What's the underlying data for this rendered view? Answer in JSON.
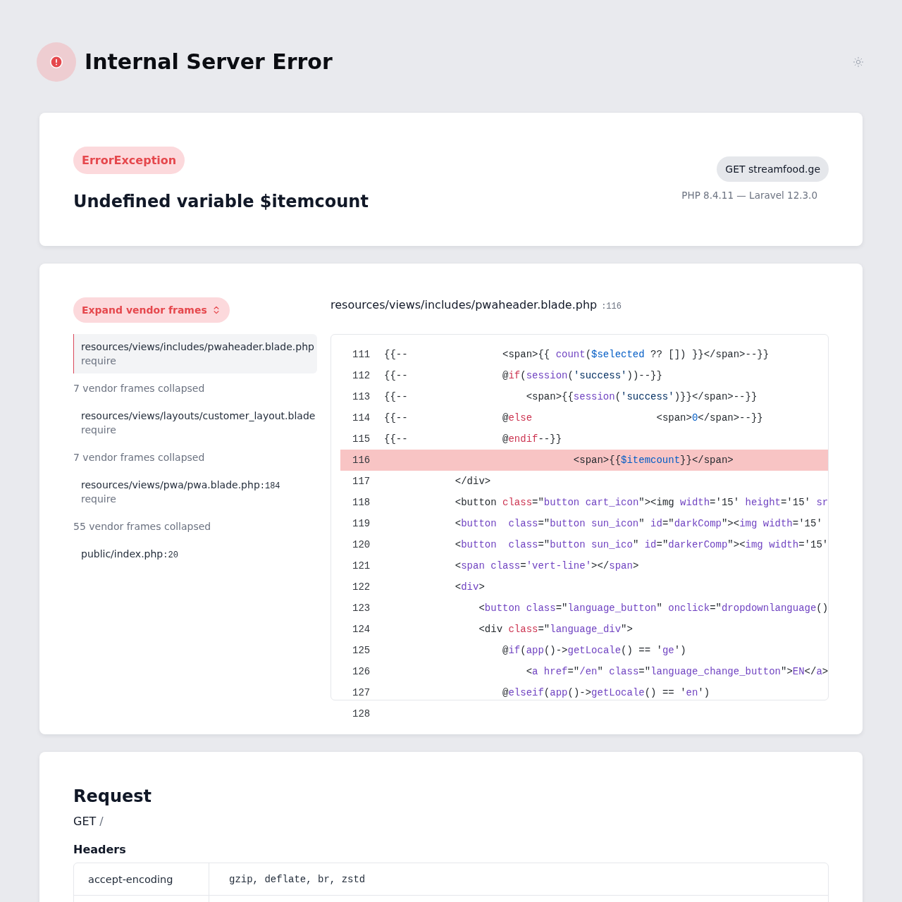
{
  "header": {
    "title": "Internal Server Error"
  },
  "exception": {
    "type": "ErrorException",
    "message": "Undefined variable $itemcount",
    "request": "GET streamfood.ge",
    "versions": "PHP 8.4.11 — Laravel 12.3.0"
  },
  "trace": {
    "expand_button": "Expand vendor frames",
    "frames": [
      {
        "kind": "frame",
        "file": "resources/views/includes/pwaheader.blade.php",
        "call": "require",
        "selected": true
      },
      {
        "kind": "collapsed",
        "label": "7 vendor frames collapsed"
      },
      {
        "kind": "frame",
        "file": "resources/views/layouts/customer_layout.blade",
        "call": "require",
        "selected": false
      },
      {
        "kind": "collapsed",
        "label": "7 vendor frames collapsed"
      },
      {
        "kind": "frame",
        "file": "resources/views/pwa/pwa.blade.php",
        "line": ":184",
        "call": "require",
        "selected": false
      },
      {
        "kind": "collapsed",
        "label": "55 vendor frames collapsed"
      },
      {
        "kind": "frame",
        "file": "public/index.php",
        "line": ":20",
        "selected": false
      }
    ]
  },
  "code": {
    "file": "resources/views/includes/pwaheader.blade.php",
    "line": ":116",
    "lines": [
      {
        "number": "111",
        "highlighted": false,
        "tokens": [
          {
            "kind": "plain",
            "text": "{{--                <span>{{ "
          },
          {
            "kind": "name",
            "text": "count"
          },
          {
            "kind": "plain",
            "text": "("
          },
          {
            "kind": "variable",
            "text": "$selected"
          },
          {
            "kind": "plain",
            "text": " ?? []) }}</span>--}}"
          }
        ]
      },
      {
        "number": "112",
        "highlighted": false,
        "tokens": [
          {
            "kind": "plain",
            "text": "{{--                @"
          },
          {
            "kind": "keyword",
            "text": "if"
          },
          {
            "kind": "plain",
            "text": "("
          },
          {
            "kind": "name",
            "text": "session"
          },
          {
            "kind": "plain",
            "text": "("
          },
          {
            "kind": "string",
            "text": "'success'"
          },
          {
            "kind": "plain",
            "text": "))--}}"
          }
        ]
      },
      {
        "number": "113",
        "highlighted": false,
        "tokens": [
          {
            "kind": "plain",
            "text": "{{--                    <span>{{"
          },
          {
            "kind": "name",
            "text": "session"
          },
          {
            "kind": "plain",
            "text": "("
          },
          {
            "kind": "string",
            "text": "'success'"
          },
          {
            "kind": "plain",
            "text": ")}}</span>--}}"
          }
        ]
      },
      {
        "number": "114",
        "highlighted": false,
        "tokens": [
          {
            "kind": "plain",
            "text": "{{--                @"
          },
          {
            "kind": "keyword",
            "text": "else"
          },
          {
            "kind": "plain",
            "text": "                     <span>"
          },
          {
            "kind": "variable",
            "text": "0"
          },
          {
            "kind": "plain",
            "text": "</span>--}}"
          }
        ]
      },
      {
        "number": "115",
        "highlighted": false,
        "tokens": [
          {
            "kind": "plain",
            "text": "{{--                @"
          },
          {
            "kind": "keyword",
            "text": "endif"
          },
          {
            "kind": "plain",
            "text": "--}}"
          }
        ]
      },
      {
        "number": "116",
        "highlighted": true,
        "tokens": [
          {
            "kind": "plain",
            "text": "                                <span>{{"
          },
          {
            "kind": "variable",
            "text": "$itemcount"
          },
          {
            "kind": "plain",
            "text": "}}</span>"
          }
        ]
      },
      {
        "number": "117",
        "highlighted": false,
        "tokens": [
          {
            "kind": "plain",
            "text": "            </div>"
          }
        ]
      },
      {
        "number": "118",
        "highlighted": false,
        "tokens": [
          {
            "kind": "plain",
            "text": "            <button "
          },
          {
            "kind": "keyword",
            "text": "class"
          },
          {
            "kind": "plain",
            "text": "=\""
          },
          {
            "kind": "name",
            "text": "button cart_icon"
          },
          {
            "kind": "plain",
            "text": "\"><img "
          },
          {
            "kind": "name",
            "text": "width"
          },
          {
            "kind": "plain",
            "text": "='15' "
          },
          {
            "kind": "name",
            "text": "height"
          },
          {
            "kind": "plain",
            "text": "='15' "
          },
          {
            "kind": "name",
            "text": "sr"
          }
        ]
      },
      {
        "number": "119",
        "highlighted": false,
        "tokens": [
          {
            "kind": "plain",
            "text": "            <"
          },
          {
            "kind": "name",
            "text": "button  class"
          },
          {
            "kind": "plain",
            "text": "=\""
          },
          {
            "kind": "name",
            "text": "button sun_icon"
          },
          {
            "kind": "plain",
            "text": "\" "
          },
          {
            "kind": "name",
            "text": "id"
          },
          {
            "kind": "plain",
            "text": "=\""
          },
          {
            "kind": "name",
            "text": "darkComp"
          },
          {
            "kind": "plain",
            "text": "\"><"
          },
          {
            "kind": "name",
            "text": "img width"
          },
          {
            "kind": "plain",
            "text": "='15'"
          }
        ]
      },
      {
        "number": "120",
        "highlighted": false,
        "tokens": [
          {
            "kind": "plain",
            "text": "            <"
          },
          {
            "kind": "name",
            "text": "button  class"
          },
          {
            "kind": "plain",
            "text": "=\""
          },
          {
            "kind": "name",
            "text": "button sun_ico"
          },
          {
            "kind": "plain",
            "text": "\" "
          },
          {
            "kind": "name",
            "text": "id"
          },
          {
            "kind": "plain",
            "text": "=\""
          },
          {
            "kind": "name",
            "text": "darkerComp"
          },
          {
            "kind": "plain",
            "text": "\"><"
          },
          {
            "kind": "name",
            "text": "img width"
          },
          {
            "kind": "plain",
            "text": "='15'"
          }
        ]
      },
      {
        "number": "121",
        "highlighted": false,
        "tokens": [
          {
            "kind": "plain",
            "text": "            <"
          },
          {
            "kind": "name",
            "text": "span class"
          },
          {
            "kind": "plain",
            "text": "="
          },
          {
            "kind": "name",
            "text": "'vert-line'"
          },
          {
            "kind": "plain",
            "text": "></"
          },
          {
            "kind": "name",
            "text": "span"
          },
          {
            "kind": "plain",
            "text": ">"
          }
        ]
      },
      {
        "number": "122",
        "highlighted": false,
        "tokens": [
          {
            "kind": "plain",
            "text": "            <"
          },
          {
            "kind": "name",
            "text": "div"
          },
          {
            "kind": "plain",
            "text": ">"
          }
        ]
      },
      {
        "number": "123",
        "highlighted": false,
        "tokens": [
          {
            "kind": "plain",
            "text": "                <"
          },
          {
            "kind": "name",
            "text": "button class"
          },
          {
            "kind": "plain",
            "text": "=\""
          },
          {
            "kind": "name",
            "text": "language_button"
          },
          {
            "kind": "plain",
            "text": "\" "
          },
          {
            "kind": "name",
            "text": "onclick"
          },
          {
            "kind": "plain",
            "text": "=\""
          },
          {
            "kind": "name",
            "text": "dropdownlanguage"
          },
          {
            "kind": "plain",
            "text": "()"
          }
        ]
      },
      {
        "number": "124",
        "highlighted": false,
        "tokens": [
          {
            "kind": "plain",
            "text": "                <div "
          },
          {
            "kind": "keyword",
            "text": "class"
          },
          {
            "kind": "plain",
            "text": "=\""
          },
          {
            "kind": "name",
            "text": "language_div"
          },
          {
            "kind": "plain",
            "text": "\">"
          }
        ]
      },
      {
        "number": "125",
        "highlighted": false,
        "tokens": [
          {
            "kind": "plain",
            "text": "                    @"
          },
          {
            "kind": "name",
            "text": "if"
          },
          {
            "kind": "plain",
            "text": "("
          },
          {
            "kind": "name",
            "text": "app"
          },
          {
            "kind": "plain",
            "text": "()->"
          },
          {
            "kind": "name",
            "text": "getLocale"
          },
          {
            "kind": "plain",
            "text": "() == '"
          },
          {
            "kind": "name",
            "text": "ge"
          },
          {
            "kind": "plain",
            "text": "')"
          }
        ]
      },
      {
        "number": "126",
        "highlighted": false,
        "tokens": [
          {
            "kind": "plain",
            "text": "                        <"
          },
          {
            "kind": "name",
            "text": "a href"
          },
          {
            "kind": "plain",
            "text": "=\""
          },
          {
            "kind": "name",
            "text": "/en"
          },
          {
            "kind": "plain",
            "text": "\" "
          },
          {
            "kind": "name",
            "text": "class"
          },
          {
            "kind": "plain",
            "text": "=\""
          },
          {
            "kind": "name",
            "text": "language_change_button"
          },
          {
            "kind": "plain",
            "text": "\">"
          },
          {
            "kind": "name",
            "text": "EN"
          },
          {
            "kind": "plain",
            "text": "</"
          },
          {
            "kind": "name",
            "text": "a"
          },
          {
            "kind": "plain",
            "text": ">"
          }
        ]
      },
      {
        "number": "127",
        "highlighted": false,
        "tokens": [
          {
            "kind": "plain",
            "text": "                    @"
          },
          {
            "kind": "name",
            "text": "elseif"
          },
          {
            "kind": "plain",
            "text": "("
          },
          {
            "kind": "name",
            "text": "app"
          },
          {
            "kind": "plain",
            "text": "()->"
          },
          {
            "kind": "name",
            "text": "getLocale"
          },
          {
            "kind": "plain",
            "text": "() == '"
          },
          {
            "kind": "name",
            "text": "en"
          },
          {
            "kind": "plain",
            "text": "')"
          }
        ]
      },
      {
        "number": "128",
        "highlighted": false
      }
    ]
  },
  "request": {
    "title": "Request",
    "method": "GET",
    "path": "/",
    "headers_title": "Headers",
    "headers": [
      {
        "name": "accept-encoding",
        "value": "gzip, deflate, br, zstd"
      }
    ]
  }
}
